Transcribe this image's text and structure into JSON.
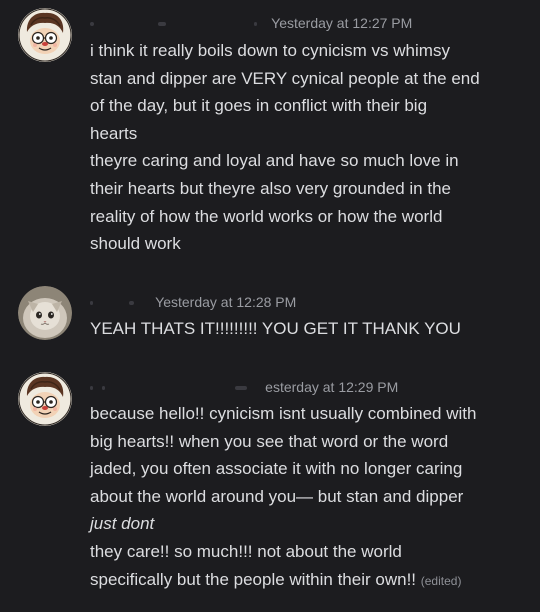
{
  "messages": [
    {
      "timestamp": "Yesterday at 12:27 PM",
      "lines": [
        "i think it really boils down to cynicism vs whimsy",
        "stan and dipper are VERY cynical people at the end",
        "of the day, but it goes in conflict with their big",
        "hearts",
        "theyre caring and loyal and have so much love in",
        "their hearts but theyre also very grounded in the",
        "reality of how the world works or how the world",
        "should work"
      ]
    },
    {
      "timestamp": "Yesterday at 12:28 PM",
      "lines": [
        "YEAH THATS IT!!!!!!!!! YOU GET IT THANK YOU"
      ]
    },
    {
      "timestamp": "esterday at 12:29 PM",
      "lines": [
        "because hello!! cynicism isnt usually combined with",
        "big hearts!! when you see that word or the word",
        "jaded, you often associate it with no longer caring",
        "about the world around you— but stan and dipper",
        "just dont",
        "they care!! so much!!! not about the world",
        "specifically but the people within their own!!"
      ],
      "edited_label": "(edited)"
    }
  ]
}
